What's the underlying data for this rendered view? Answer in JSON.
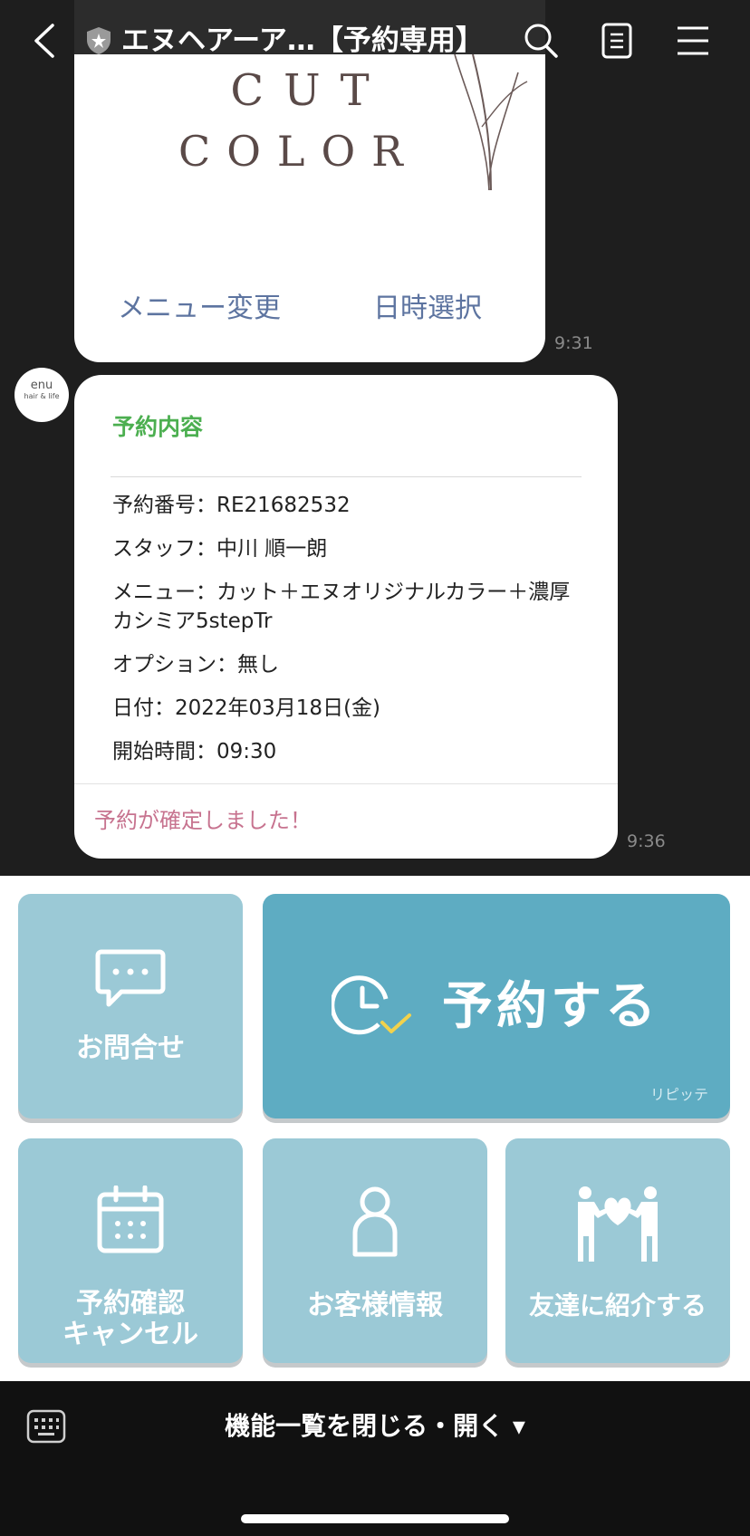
{
  "header": {
    "title": "エヌヘアーア…【予約専用】"
  },
  "message1": {
    "image_text_line1": "CUT",
    "image_text_line2": "COLOR",
    "action_left": "メニュー変更",
    "action_right": "日時選択",
    "time": "9:31"
  },
  "avatar": {
    "text_line1": "enu",
    "text_line2": "hair & life"
  },
  "message2": {
    "title": "予約内容",
    "details": {
      "number": "予約番号：RE21682532",
      "staff": "スタッフ：中川 順一朗",
      "menu": "メニュー：カット＋エヌオリジナルカラー＋濃厚カシミア5stepTr",
      "option": "オプション：無し",
      "date": "日付：2022年03月18日(金)",
      "start": "開始時間：09:30"
    },
    "status": "予約が確定しました！",
    "time": "9:36"
  },
  "rich_menu": {
    "contact": "お問合せ",
    "reserve": "予約する",
    "reserve_sub": "リピッテ",
    "confirm_line1": "予約確認",
    "confirm_line2": "キャンセル",
    "customer": "お客様情報",
    "friend": "友達に紹介する"
  },
  "bottom_bar": {
    "toggle": "機能一覧を閉じる・開く ▾"
  },
  "colors": {
    "tile": "#9bc9d6",
    "reserve_tile": "#5eacc2",
    "title_green": "#4caf50",
    "status_pink": "#c7738f",
    "link_blue": "#5d74a0"
  }
}
